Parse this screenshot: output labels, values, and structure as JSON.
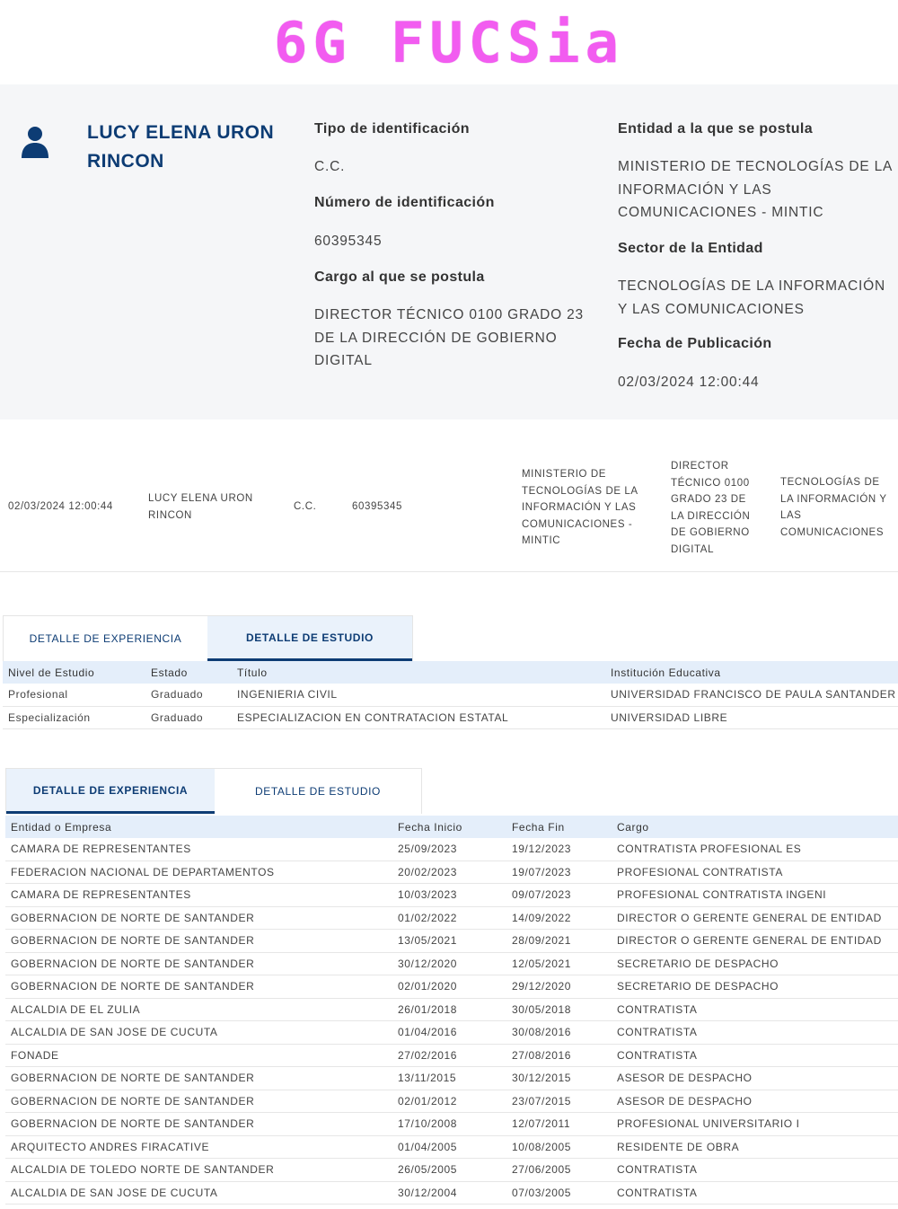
{
  "brand": {
    "logo_text": "6G FUCSia"
  },
  "candidate": {
    "name": "LUCY ELENA URON RINCON",
    "id_type_label": "Tipo de identificación",
    "id_type": "C.C.",
    "id_number_label": "Número de identificación",
    "id_number": "60395345",
    "position_label": "Cargo al que se postula",
    "position": "DIRECTOR TÉCNICO 0100 GRADO 23 DE LA DIRECCIÓN DE GOBIERNO DIGITAL",
    "entity_label": "Entidad a la que se postula",
    "entity": "MINISTERIO DE TECNOLOGÍAS DE LA INFORMACIÓN Y LAS COMUNICACIONES - MINTIC",
    "sector_label": "Sector de la Entidad",
    "sector": "TECNOLOGÍAS DE LA INFORMACIÓN Y LAS COMUNICACIONES",
    "pub_date_label": "Fecha de Publicación",
    "pub_date": "02/03/2024 12:00:44"
  },
  "summary_row": {
    "date": "02/03/2024 12:00:44",
    "name": "LUCY ELENA URON RINCON",
    "id_type": "C.C.",
    "id_number": "60395345",
    "entity": "MINISTERIO DE TECNOLOGÍAS DE LA INFORMACIÓN Y LAS COMUNICACIONES - MINTIC",
    "position": "DIRECTOR TÉCNICO 0100 GRADO 23 DE LA DIRECCIÓN DE GOBIERNO DIGITAL",
    "sector": "TECNOLOGÍAS DE LA INFORMACIÓN Y LAS COMUNICACIONES"
  },
  "tabs": {
    "experience": "DETALLE DE EXPERIENCIA",
    "study": "DETALLE DE ESTUDIO"
  },
  "study_table": {
    "headers": [
      "Nivel de Estudio",
      "Estado",
      "Título",
      "Institución Educativa"
    ],
    "rows": [
      [
        "Profesional",
        "Graduado",
        "INGENIERIA CIVIL",
        "UNIVERSIDAD FRANCISCO DE PAULA SANTANDER"
      ],
      [
        "Especialización",
        "Graduado",
        "ESPECIALIZACION EN CONTRATACION ESTATAL",
        "UNIVERSIDAD LIBRE"
      ]
    ]
  },
  "experience_table": {
    "headers": [
      "Entidad o Empresa",
      "Fecha Inicio",
      "Fecha Fin",
      "Cargo"
    ],
    "rows": [
      [
        "CAMARA DE REPRESENTANTES",
        "25/09/2023",
        "19/12/2023",
        "CONTRATISTA PROFESIONAL ES"
      ],
      [
        "FEDERACION NACIONAL DE DEPARTAMENTOS",
        "20/02/2023",
        "19/07/2023",
        "PROFESIONAL CONTRATISTA"
      ],
      [
        "CAMARA DE REPRESENTANTES",
        "10/03/2023",
        "09/07/2023",
        "PROFESIONAL CONTRATISTA INGENI"
      ],
      [
        "GOBERNACION DE NORTE DE SANTANDER",
        "01/02/2022",
        "14/09/2022",
        "DIRECTOR O GERENTE GENERAL DE ENTIDAD"
      ],
      [
        "GOBERNACION DE NORTE DE SANTANDER",
        "13/05/2021",
        "28/09/2021",
        "DIRECTOR O GERENTE GENERAL DE ENTIDAD"
      ],
      [
        "GOBERNACION DE NORTE DE SANTANDER",
        "30/12/2020",
        "12/05/2021",
        "SECRETARIO DE DESPACHO"
      ],
      [
        "GOBERNACION DE NORTE DE SANTANDER",
        "02/01/2020",
        "29/12/2020",
        "SECRETARIO DE DESPACHO"
      ],
      [
        "ALCALDIA DE EL ZULIA",
        "26/01/2018",
        "30/05/2018",
        "CONTRATISTA"
      ],
      [
        "ALCALDIA DE SAN JOSE DE CUCUTA",
        "01/04/2016",
        "30/08/2016",
        "CONTRATISTA"
      ],
      [
        "FONADE",
        "27/02/2016",
        "27/08/2016",
        "CONTRATISTA"
      ],
      [
        "GOBERNACION DE NORTE DE SANTANDER",
        "13/11/2015",
        "30/12/2015",
        "ASESOR DE DESPACHO"
      ],
      [
        "GOBERNACION DE NORTE DE SANTANDER",
        "02/01/2012",
        "23/07/2015",
        "ASESOR DE DESPACHO"
      ],
      [
        "GOBERNACION DE NORTE DE SANTANDER",
        "17/10/2008",
        "12/07/2011",
        "PROFESIONAL UNIVERSITARIO I"
      ],
      [
        "ARQUITECTO ANDRES FIRACATIVE",
        "01/04/2005",
        "10/08/2005",
        "RESIDENTE DE OBRA"
      ],
      [
        "ALCALDIA DE TOLEDO NORTE DE SANTANDER",
        "26/05/2005",
        "27/06/2005",
        "CONTRATISTA"
      ],
      [
        "ALCALDIA DE SAN JOSE DE CUCUTA",
        "30/12/2004",
        "07/03/2005",
        "CONTRATISTA"
      ]
    ]
  },
  "colors": {
    "brand_pink": "#f25cf0",
    "navy": "#0d3c74",
    "header_bg": "#e4eefa",
    "panel_bg": "#f5f6f8"
  },
  "icons": {
    "user": "user-icon"
  }
}
